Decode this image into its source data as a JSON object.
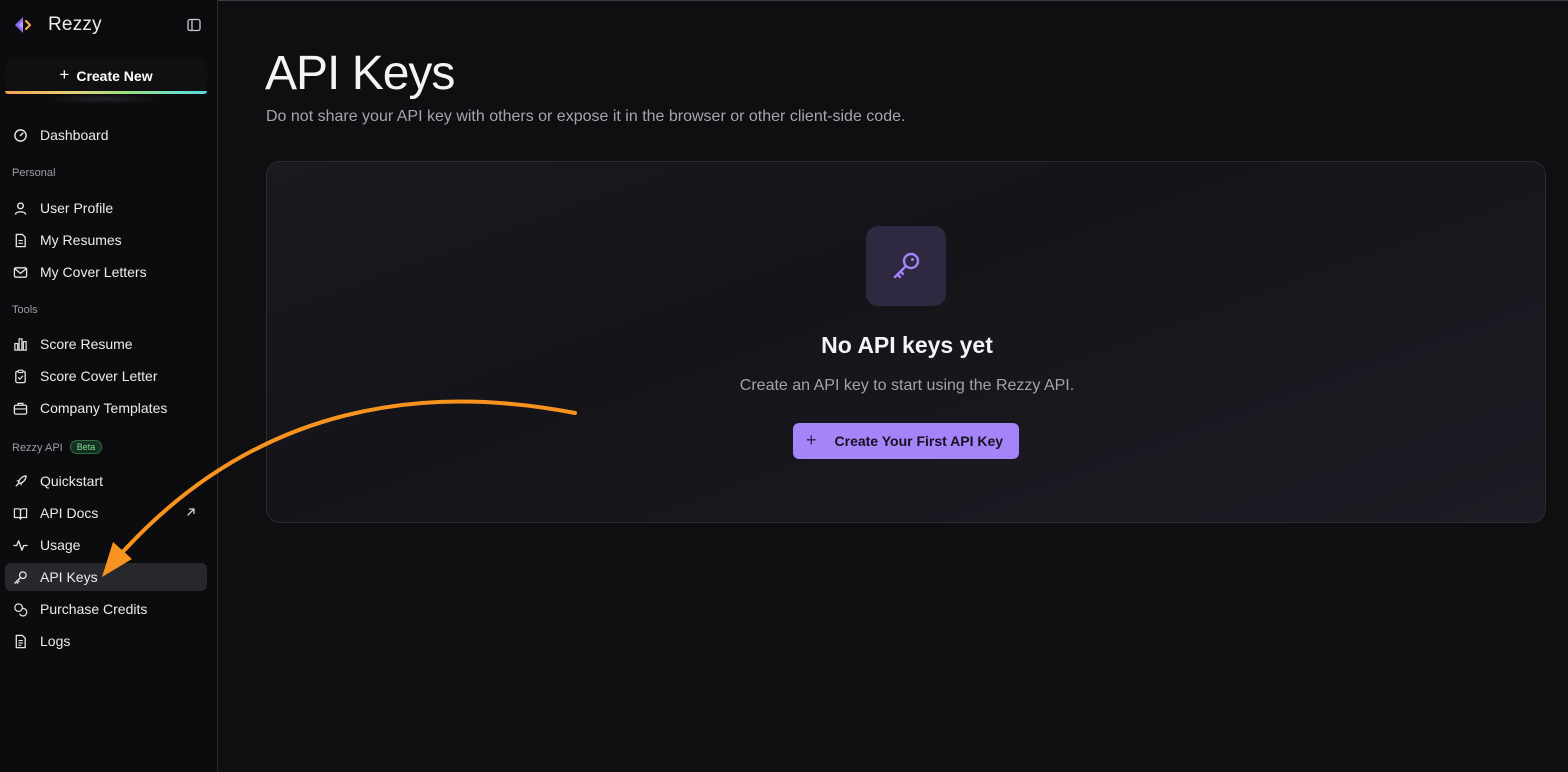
{
  "app": {
    "name": "Rezzy",
    "accent_color": "#a583f8",
    "annotation_arrow_color": "#f7931e"
  },
  "sidebar": {
    "create_new_label": "Create New",
    "dashboard": {
      "label": "Dashboard",
      "icon": "gauge-icon"
    },
    "sections": {
      "personal": "Personal",
      "tools": "Tools",
      "rezzy_api": "Rezzy API",
      "beta_badge": "Beta"
    },
    "personal_items": [
      {
        "label": "User Profile",
        "icon": "user-icon"
      },
      {
        "label": "My Resumes",
        "icon": "document-icon"
      },
      {
        "label": "My Cover Letters",
        "icon": "mail-icon"
      }
    ],
    "tools_items": [
      {
        "label": "Score Resume",
        "icon": "bar-chart-icon"
      },
      {
        "label": "Score Cover Letter",
        "icon": "clipboard-icon"
      },
      {
        "label": "Company Templates",
        "icon": "briefcase-icon"
      }
    ],
    "api_items": [
      {
        "label": "Quickstart",
        "icon": "rocket-icon"
      },
      {
        "label": "API Docs",
        "icon": "book-icon",
        "external": true
      },
      {
        "label": "Usage",
        "icon": "activity-icon"
      },
      {
        "label": "API Keys",
        "icon": "key-icon",
        "active": true
      },
      {
        "label": "Purchase Credits",
        "icon": "coins-icon"
      },
      {
        "label": "Logs",
        "icon": "file-text-icon"
      }
    ]
  },
  "main": {
    "title": "API Keys",
    "subtitle": "Do not share your API key with others or expose it in the browser or other client-side code.",
    "empty_state": {
      "icon": "key-icon",
      "title": "No API keys yet",
      "description": "Create an API key to start using the Rezzy API.",
      "button_label": "Create Your First API Key"
    }
  }
}
